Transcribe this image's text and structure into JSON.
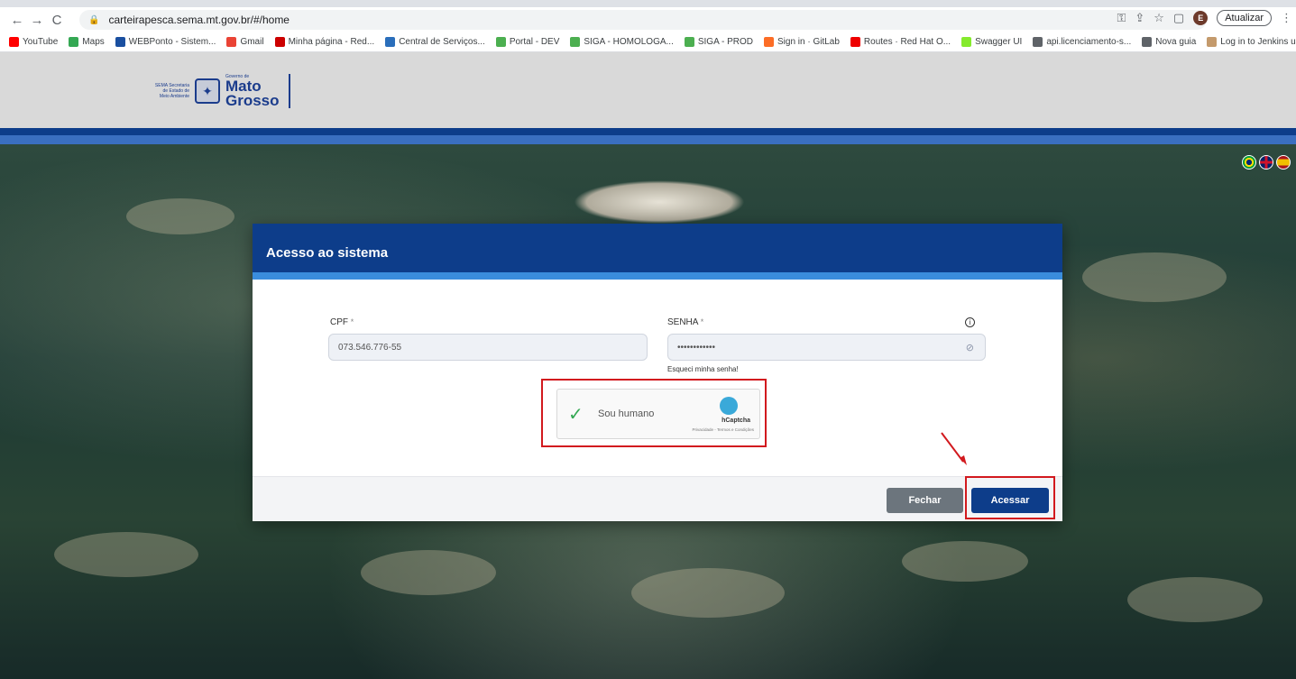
{
  "browser": {
    "url": "carteirapesca.sema.mt.gov.br/#/home",
    "update_label": "Atualizar",
    "profile_initial": "E",
    "bookmarks": [
      {
        "label": "YouTube",
        "color": "#ff0000"
      },
      {
        "label": "Maps",
        "color": "#34a853"
      },
      {
        "label": "WEBPonto - Sistem...",
        "color": "#1a4fa0"
      },
      {
        "label": "Gmail",
        "color": "#ea4335"
      },
      {
        "label": "Minha página - Red...",
        "color": "#cc0000"
      },
      {
        "label": "Central de Serviços...",
        "color": "#2a6ebb"
      },
      {
        "label": "Portal - DEV",
        "color": "#4caf50"
      },
      {
        "label": "SIGA - HOMOLOGA...",
        "color": "#4caf50"
      },
      {
        "label": "SIGA - PROD",
        "color": "#4caf50"
      },
      {
        "label": "Sign in · GitLab",
        "color": "#fc6d26"
      },
      {
        "label": "Routes · Red Hat O...",
        "color": "#ee0000"
      },
      {
        "label": "Swagger UI",
        "color": "#85ea2d"
      },
      {
        "label": "api.licenciamento-s...",
        "color": "#5f6368"
      },
      {
        "label": "Nova guia",
        "color": "#5f6368"
      },
      {
        "label": "Log in to Jenkins us...",
        "color": "#c49a6c"
      }
    ]
  },
  "header": {
    "logo_small": "SEMA Secretaria de Estado de Meio Ambiente",
    "logo_gov": "Governo de",
    "logo_line1": "Mato",
    "logo_line2": "Grosso"
  },
  "modal": {
    "title": "Acesso ao sistema",
    "cpf_label": "CPF",
    "cpf_value": "073.546.776-55",
    "senha_label": "SENHA",
    "senha_value": "••••••••••••",
    "required_mark": "*",
    "forgot_label": "Esqueci minha senha!",
    "captcha_label": "Sou humano",
    "captcha_brand": "hCaptcha",
    "captcha_links": "Privacidade - Termos e Condições",
    "close_label": "Fechar",
    "access_label": "Acessar"
  },
  "colors": {
    "primary": "#0d3d8a",
    "accent_stripe": "#3a8ddd",
    "highlight": "#d2191e",
    "close_button": "#6c757d"
  }
}
